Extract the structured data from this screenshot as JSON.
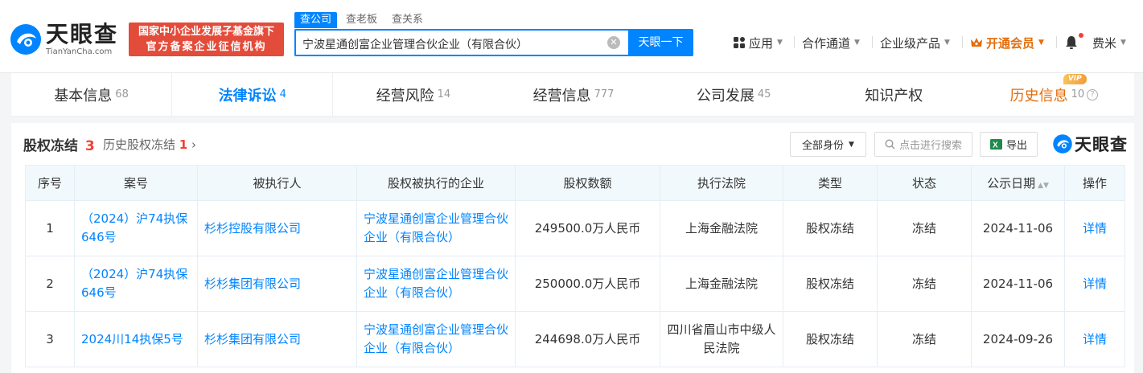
{
  "header": {
    "logo_cn": "天眼查",
    "logo_en": "TianYanCha.com",
    "banner_line1": "国家中小企业发展子基金旗下",
    "banner_line2": "官方备案企业征信机构",
    "search_tabs": [
      "查公司",
      "查老板",
      "查关系"
    ],
    "search_value": "宁波星通创富企业管理合伙企业（有限合伙）",
    "search_button": "天眼一下",
    "nav": {
      "apps": "应用",
      "channel": "合作通道",
      "enterprise": "企业级产品",
      "vip": "开通会员",
      "user": "费米"
    }
  },
  "tabs": [
    {
      "label": "基本信息",
      "count": "68"
    },
    {
      "label": "法律诉讼",
      "count": "4"
    },
    {
      "label": "经营风险",
      "count": "14"
    },
    {
      "label": "经营信息",
      "count": "777"
    },
    {
      "label": "公司发展",
      "count": "45"
    },
    {
      "label": "知识产权",
      "count": ""
    },
    {
      "label": "历史信息",
      "count": "10",
      "badge": "VIP"
    }
  ],
  "panel": {
    "title": "股权冻结",
    "count": "3",
    "history_label": "历史股权冻结",
    "history_count": "1",
    "filter_button": "全部身份",
    "search_placeholder": "点击进行搜索",
    "export_button": "导出",
    "watermark": "天眼查"
  },
  "table": {
    "headers": [
      "序号",
      "案号",
      "被执行人",
      "股权被执行的企业",
      "股权数额",
      "执行法院",
      "类型",
      "状态",
      "公示日期",
      "操作"
    ],
    "rows": [
      {
        "no": "1",
        "case": "（2024）沪74执保646号",
        "executed": "杉杉控股有限公司",
        "company": "宁波星通创富企业管理合伙企业（有限合伙）",
        "amount": "249500.0万人民币",
        "court": "上海金融法院",
        "type": "股权冻结",
        "status": "冻结",
        "date": "2024-11-06",
        "action": "详情"
      },
      {
        "no": "2",
        "case": "（2024）沪74执保646号",
        "executed": "杉杉集团有限公司",
        "company": "宁波星通创富企业管理合伙企业（有限合伙）",
        "amount": "250000.0万人民币",
        "court": "上海金融法院",
        "type": "股权冻结",
        "status": "冻结",
        "date": "2024-11-06",
        "action": "详情"
      },
      {
        "no": "3",
        "case": "2024川14执保5号",
        "executed": "杉杉集团有限公司",
        "company": "宁波星通创富企业管理合伙企业（有限合伙）",
        "amount": "244698.0万人民币",
        "court": "四川省眉山市中级人民法院",
        "type": "股权冻结",
        "status": "冻结",
        "date": "2024-09-26",
        "action": "详情"
      }
    ]
  },
  "colors": {
    "brand_blue": "#0084ff",
    "alert_red": "#f04134",
    "vip_orange": "#e46d0a"
  }
}
